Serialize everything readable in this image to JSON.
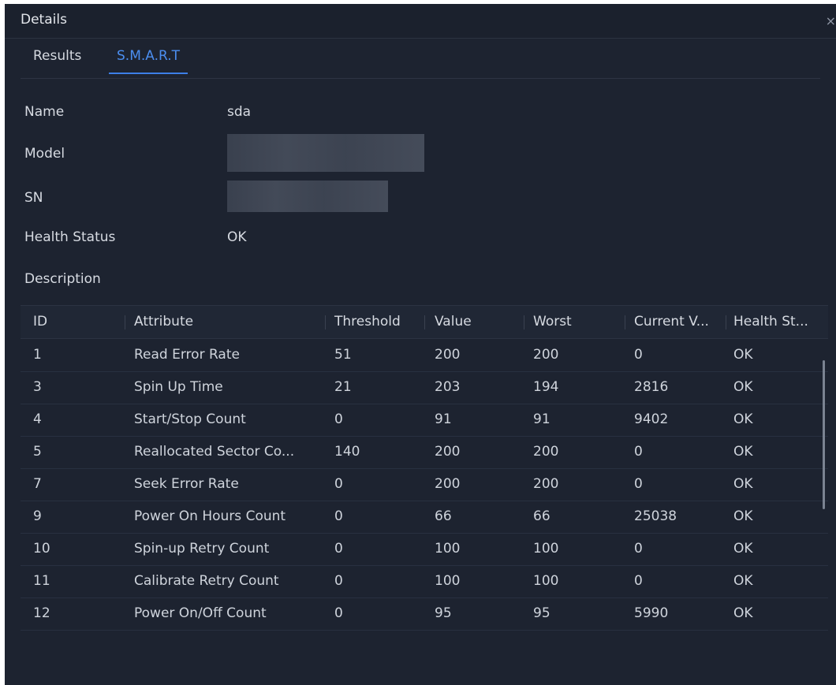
{
  "dialog": {
    "title": "Details",
    "close_icon": "close-icon"
  },
  "tabs": [
    {
      "label": "Results",
      "active": false
    },
    {
      "label": "S.M.A.R.T",
      "active": true
    }
  ],
  "info": {
    "name_label": "Name",
    "name_value": "sda",
    "model_label": "Model",
    "sn_label": "SN",
    "health_label": "Health Status",
    "health_value": "OK",
    "description_label": "Description"
  },
  "table": {
    "headers": [
      "ID",
      "Attribute",
      "Threshold",
      "Value",
      "Worst",
      "Current V...",
      "Health St..."
    ],
    "rows": [
      [
        "1",
        "Read Error Rate",
        "51",
        "200",
        "200",
        "0",
        "OK"
      ],
      [
        "3",
        "Spin Up Time",
        "21",
        "203",
        "194",
        "2816",
        "OK"
      ],
      [
        "4",
        "Start/Stop Count",
        "0",
        "91",
        "91",
        "9402",
        "OK"
      ],
      [
        "5",
        "Reallocated Sector Co...",
        "140",
        "200",
        "200",
        "0",
        "OK"
      ],
      [
        "7",
        "Seek Error Rate",
        "0",
        "200",
        "200",
        "0",
        "OK"
      ],
      [
        "9",
        "Power On Hours Count",
        "0",
        "66",
        "66",
        "25038",
        "OK"
      ],
      [
        "10",
        "Spin-up Retry Count",
        "0",
        "100",
        "100",
        "0",
        "OK"
      ],
      [
        "11",
        "Calibrate Retry Count",
        "0",
        "100",
        "100",
        "0",
        "OK"
      ],
      [
        "12",
        "Power On/Off Count",
        "0",
        "95",
        "95",
        "5990",
        "OK"
      ]
    ]
  },
  "colors": {
    "background": "#1d2330",
    "accent": "#3d7fe7",
    "text": "#d7dbe2"
  }
}
